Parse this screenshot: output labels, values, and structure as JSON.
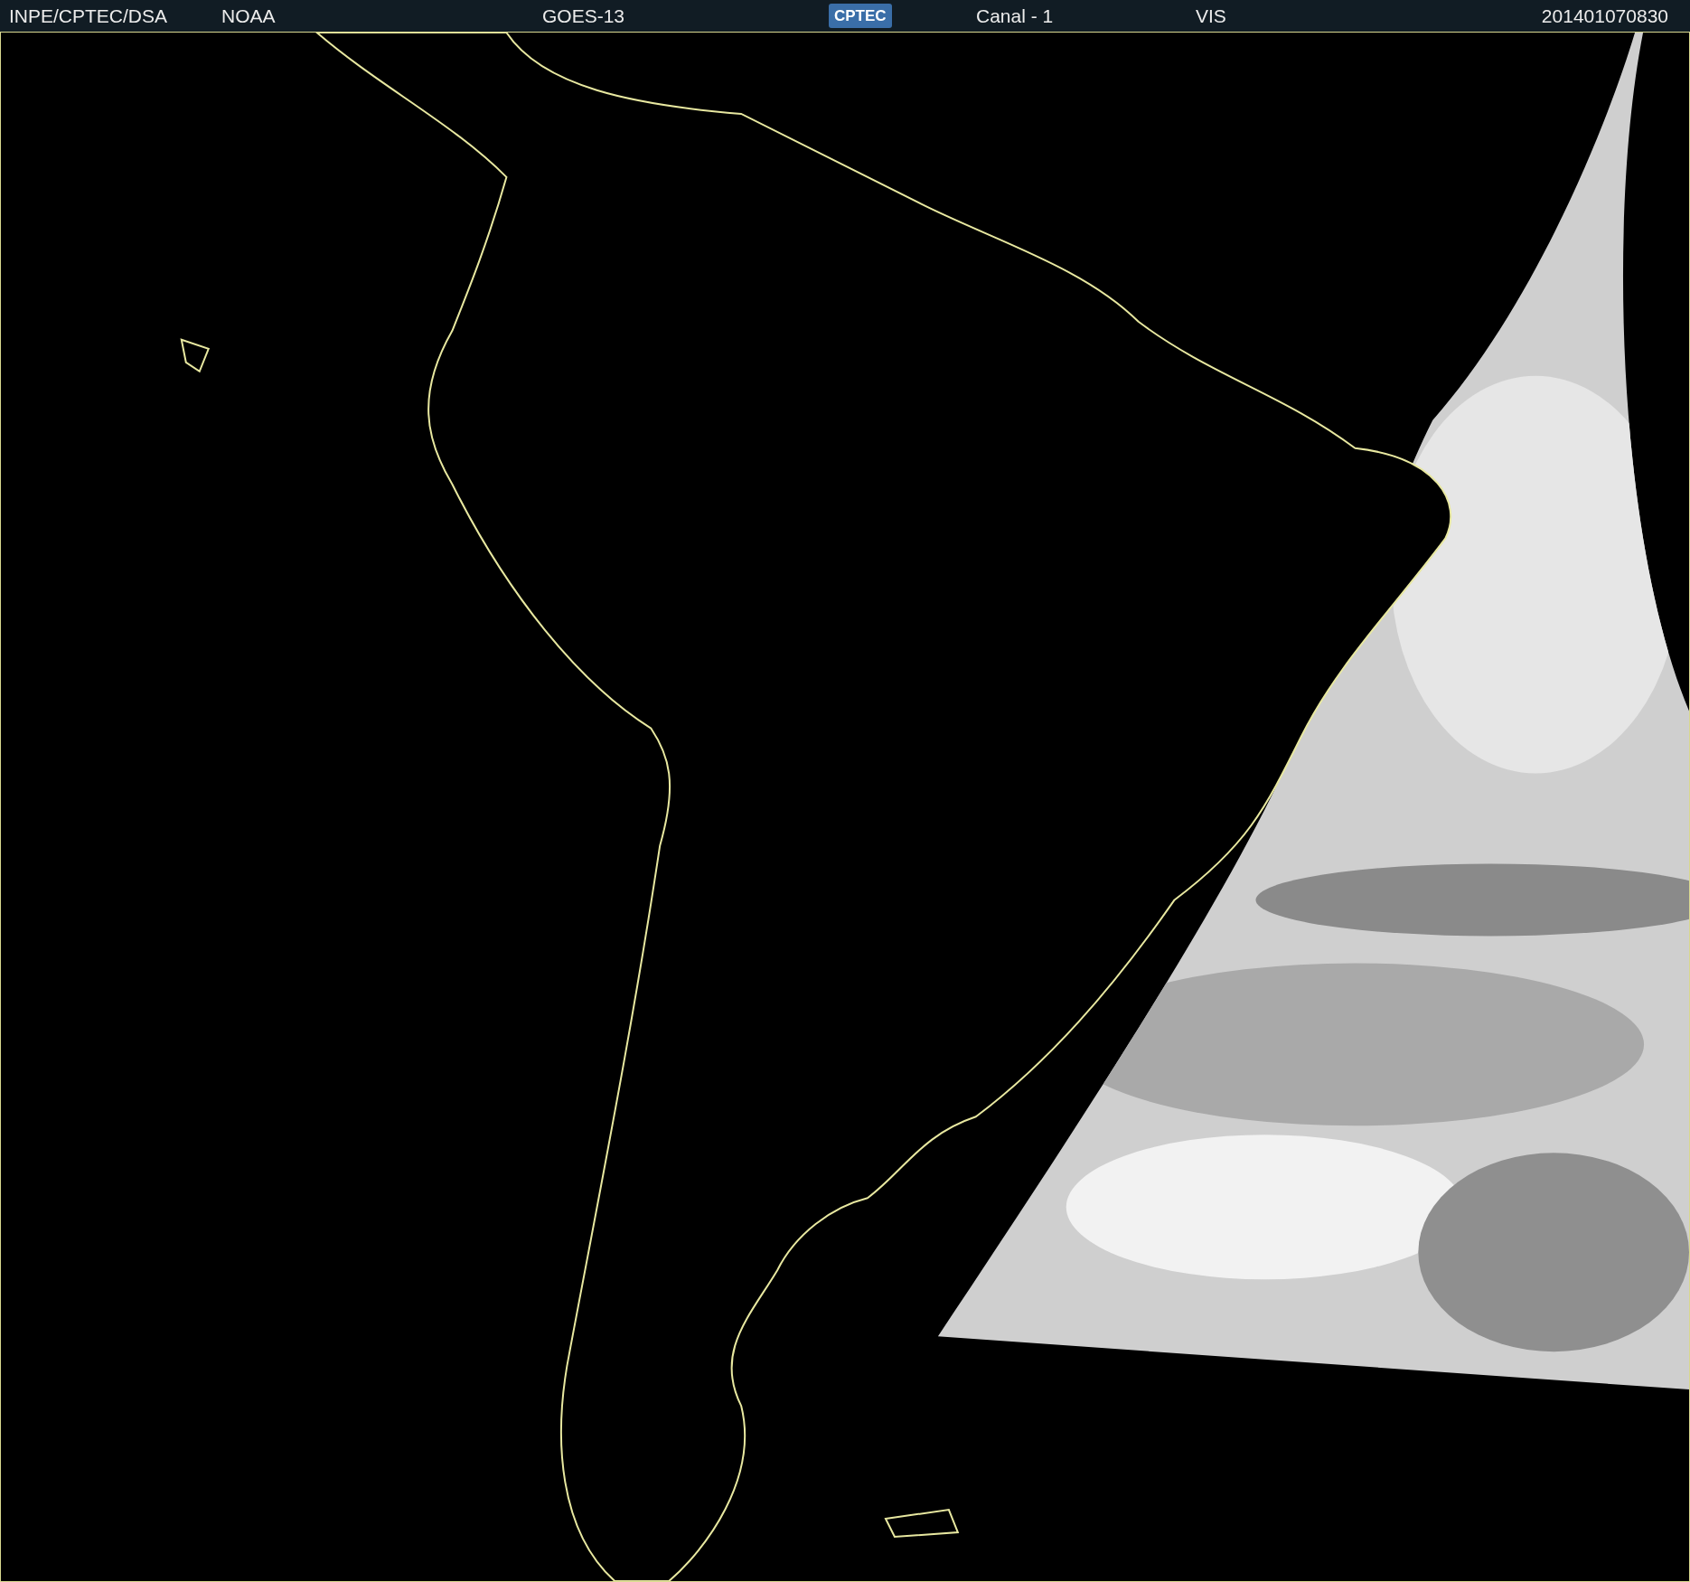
{
  "header": {
    "items": [
      {
        "kind": "text",
        "text": "INPE/CPTEC/DSA"
      },
      {
        "kind": "text",
        "text": "NOAA"
      },
      {
        "kind": "text",
        "text": "GOES-13"
      },
      {
        "kind": "logo",
        "text": "CPTEC"
      },
      {
        "kind": "text",
        "text": "Canal - 1"
      },
      {
        "kind": "text",
        "text": "VIS"
      },
      {
        "kind": "text",
        "text": "201401070830"
      }
    ]
  }
}
